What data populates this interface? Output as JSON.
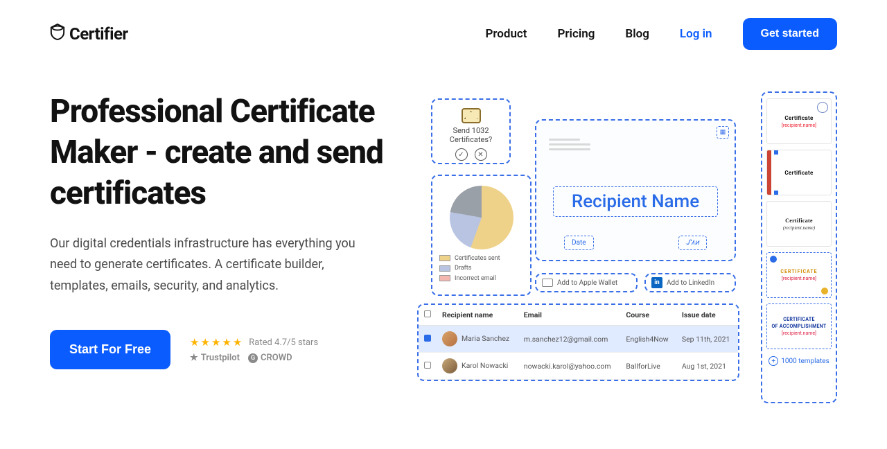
{
  "brand": "Certifier",
  "nav": {
    "product": "Product",
    "pricing": "Pricing",
    "blog": "Blog",
    "login": "Log in",
    "cta": "Get started"
  },
  "hero": {
    "title": "Professional Certificate Maker - create and send certificates",
    "subtitle": "Our digital credentials infrastructure has everything you need to generate certificates. A certificate builder, templates, emails, security, and analytics.",
    "cta": "Start For Free",
    "rating_label": "Rated 4.7/5 stars",
    "badge_trustpilot": "Trustpilot",
    "badge_crowd": "CROWD"
  },
  "collage": {
    "send": {
      "line1": "Send 1032",
      "line2": "Certificates?"
    },
    "pie_legend": {
      "sent": "Certificates sent",
      "drafts": "Drafts",
      "incorrect": "Incorrect email"
    },
    "main": {
      "recipient": "Recipient Name",
      "date": "Date",
      "sig": "ᔑ٨ͷ"
    },
    "apple": "Add to Apple Wallet",
    "linkedin": "Add to LinkedIn",
    "table": {
      "headers": {
        "name": "Recipient name",
        "email": "Email",
        "course": "Course",
        "date": "Issue date"
      },
      "rows": [
        {
          "name": "Maria Sanchez",
          "email": "m.sanchez12@gmail.com",
          "course": "English4Now",
          "date": "Sep 11th, 2021"
        },
        {
          "name": "Karol Nowacki",
          "email": "nowacki.karol@yahoo.com",
          "course": "BallforLive",
          "date": "Aug 1st, 2021"
        }
      ]
    },
    "templates": {
      "t1_title": "Certificate",
      "t1_rn": "[recipient.name]",
      "t2_title": "Certificate",
      "t3_title": "Certificate",
      "t3_rn": "(recipient.name)",
      "t4_title": "CERTIFICATE",
      "t4_rn": "[recipient.name]",
      "t5_title": "CERTIFICATE",
      "t5_sub": "OF ACCOMPLISHMENT",
      "t5_rn": "[recipient.name]",
      "footer": "1000 templates"
    }
  }
}
